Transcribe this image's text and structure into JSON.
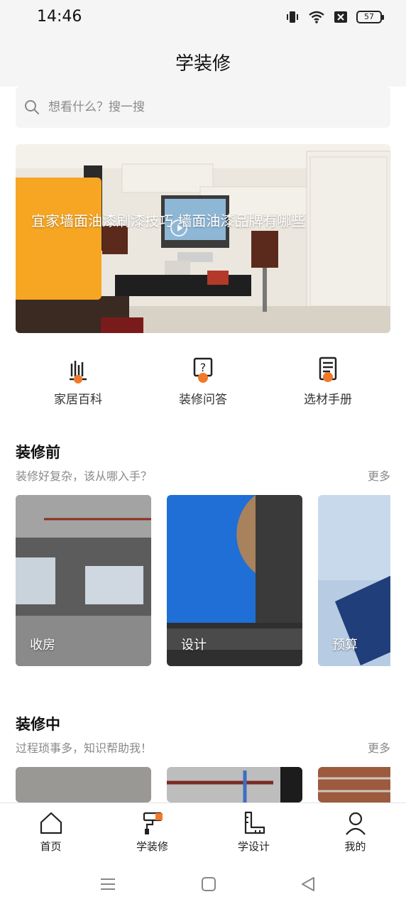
{
  "status_bar": {
    "time": "14:46",
    "battery": "57"
  },
  "header": {
    "title": "学装修"
  },
  "search": {
    "placeholder": "想看什么？搜一搜"
  },
  "banner": {
    "title": "宜家墙面油漆刷漆技巧 墙面油漆品牌有哪些"
  },
  "quick_nav": [
    {
      "label": "家居百科",
      "icon": "encyclopedia-icon"
    },
    {
      "label": "装修问答",
      "icon": "qa-icon"
    },
    {
      "label": "选材手册",
      "icon": "manual-icon"
    }
  ],
  "sections": [
    {
      "title": "装修前",
      "subtitle": "装修好复杂，该从哪入手？",
      "more": "更多",
      "cards": [
        {
          "label": "收房"
        },
        {
          "label": "设计"
        },
        {
          "label": "预算"
        }
      ]
    },
    {
      "title": "装修中",
      "subtitle": "过程琐事多，知识帮助我！",
      "more": "更多"
    }
  ],
  "tab_bar": [
    {
      "label": "首页",
      "icon": "home-icon"
    },
    {
      "label": "学装修",
      "icon": "paint-roller-icon",
      "active": true
    },
    {
      "label": "学设计",
      "icon": "ruler-icon"
    },
    {
      "label": "我的",
      "icon": "user-icon"
    }
  ],
  "colors": {
    "accent": "#f6a623",
    "brand_orange": "#f07a2a",
    "text_gray": "#8a8a8a"
  }
}
